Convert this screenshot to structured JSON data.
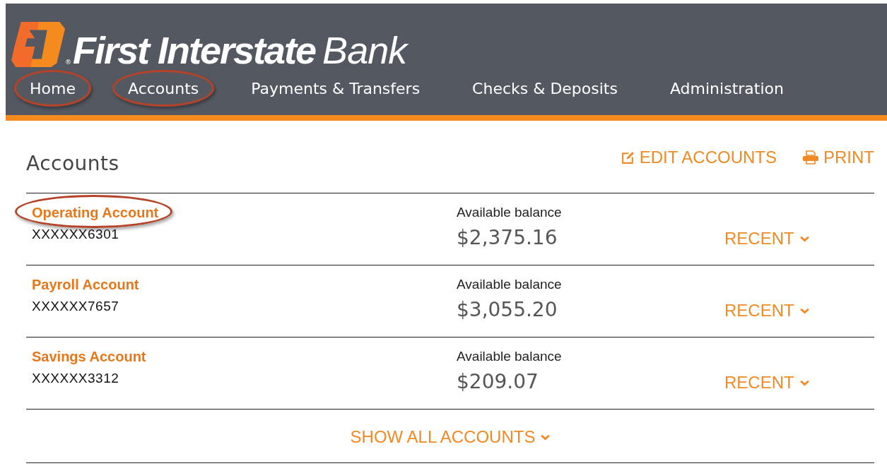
{
  "brand": {
    "name": "First Interstate",
    "mark": "®",
    "suffix": "Bank"
  },
  "nav": [
    {
      "label": "Home",
      "circled": true
    },
    {
      "label": "Accounts",
      "circled": true
    },
    {
      "label": "Payments & Transfers",
      "circled": false
    },
    {
      "label": "Checks & Deposits",
      "circled": false
    },
    {
      "label": "Administration",
      "circled": false
    }
  ],
  "page_title": "Accounts",
  "actions": [
    {
      "kind": "edit",
      "label": "EDIT ACCOUNTS"
    },
    {
      "kind": "print",
      "label": "PRINT"
    }
  ],
  "accounts": [
    {
      "name": "Operating Account",
      "number": "XXXXXX6301",
      "balance_label": "Available balance",
      "balance": "$2,375.16",
      "recent": "RECENT",
      "circled": true
    },
    {
      "name": "Payroll Account",
      "number": "XXXXXX7657",
      "balance_label": "Available balance",
      "balance": "$3,055.20",
      "recent": "RECENT",
      "circled": false
    },
    {
      "name": "Savings Account",
      "number": "XXXXXX3312",
      "balance_label": "Available balance",
      "balance": "$209.07",
      "recent": "RECENT",
      "circled": false
    }
  ],
  "show_all": "SHOW ALL ACCOUNTS"
}
